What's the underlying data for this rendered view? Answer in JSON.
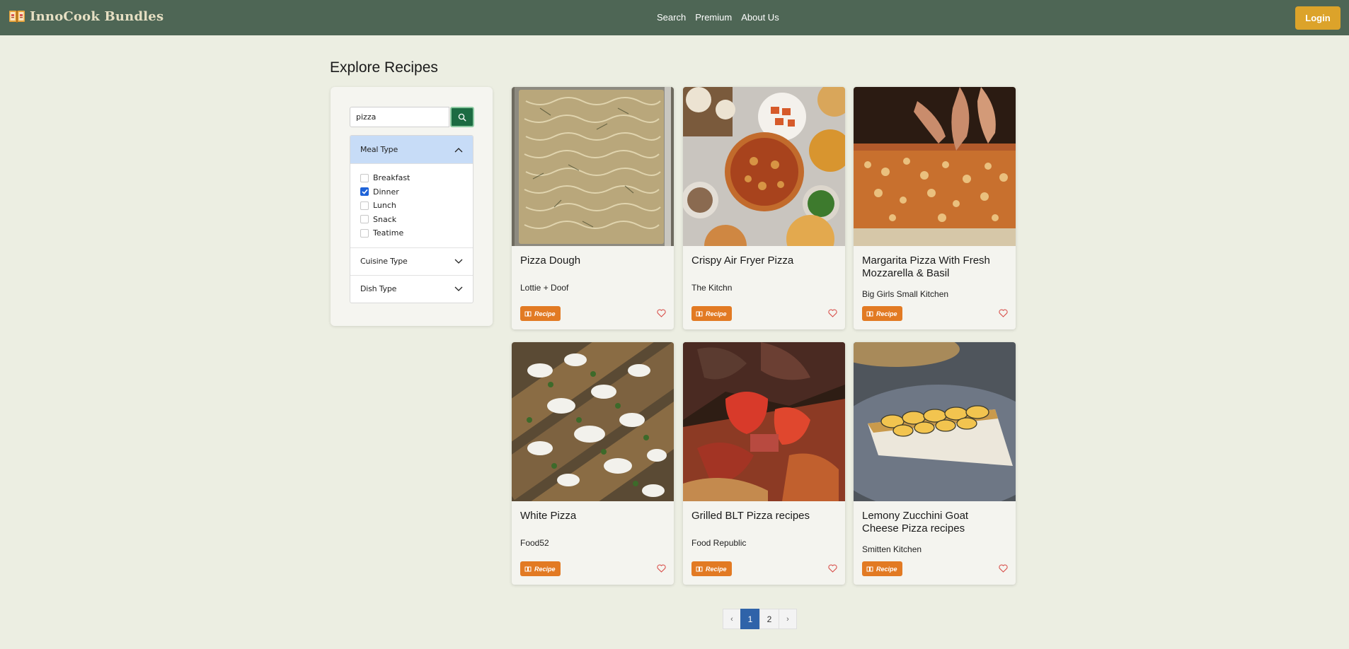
{
  "nav": {
    "brand": "InnoCook Bundles",
    "links": [
      "Search",
      "Premium",
      "About Us"
    ],
    "login_label": "Login"
  },
  "page_title": "Explore Recipes",
  "search": {
    "value": "pizza",
    "placeholder": ""
  },
  "filters": {
    "meal_type": {
      "label": "Meal Type",
      "expanded": true,
      "options": [
        {
          "label": "Breakfast",
          "checked": false
        },
        {
          "label": "Dinner",
          "checked": true
        },
        {
          "label": "Lunch",
          "checked": false
        },
        {
          "label": "Snack",
          "checked": false
        },
        {
          "label": "Teatime",
          "checked": false
        }
      ]
    },
    "cuisine_type": {
      "label": "Cuisine Type",
      "expanded": false
    },
    "dish_type": {
      "label": "Dish Type",
      "expanded": false
    }
  },
  "recipes": [
    {
      "title": "Pizza Dough",
      "source": "Lottie + Doof",
      "badge": "Recipe"
    },
    {
      "title": "Crispy Air Fryer Pizza",
      "source": "The Kitchn",
      "badge": "Recipe"
    },
    {
      "title": "Margarita Pizza With Fresh Mozzarella & Basil",
      "source": "Big Girls Small Kitchen",
      "badge": "Recipe"
    },
    {
      "title": "White Pizza",
      "source": "Food52",
      "badge": "Recipe"
    },
    {
      "title": "Grilled BLT Pizza recipes",
      "source": "Food Republic",
      "badge": "Recipe"
    },
    {
      "title": "Lemony Zucchini Goat Cheese Pizza recipes",
      "source": "Smitten Kitchen",
      "badge": "Recipe"
    }
  ],
  "pagination": {
    "prev": "‹",
    "pages": [
      "1",
      "2"
    ],
    "current": "1",
    "next": "›"
  },
  "colors": {
    "navbar": "#4e6655",
    "login": "#dca32a",
    "background": "#eceee2",
    "badge": "#e27a23",
    "search_button": "#1c6b42",
    "active_page": "#2f63a9"
  }
}
